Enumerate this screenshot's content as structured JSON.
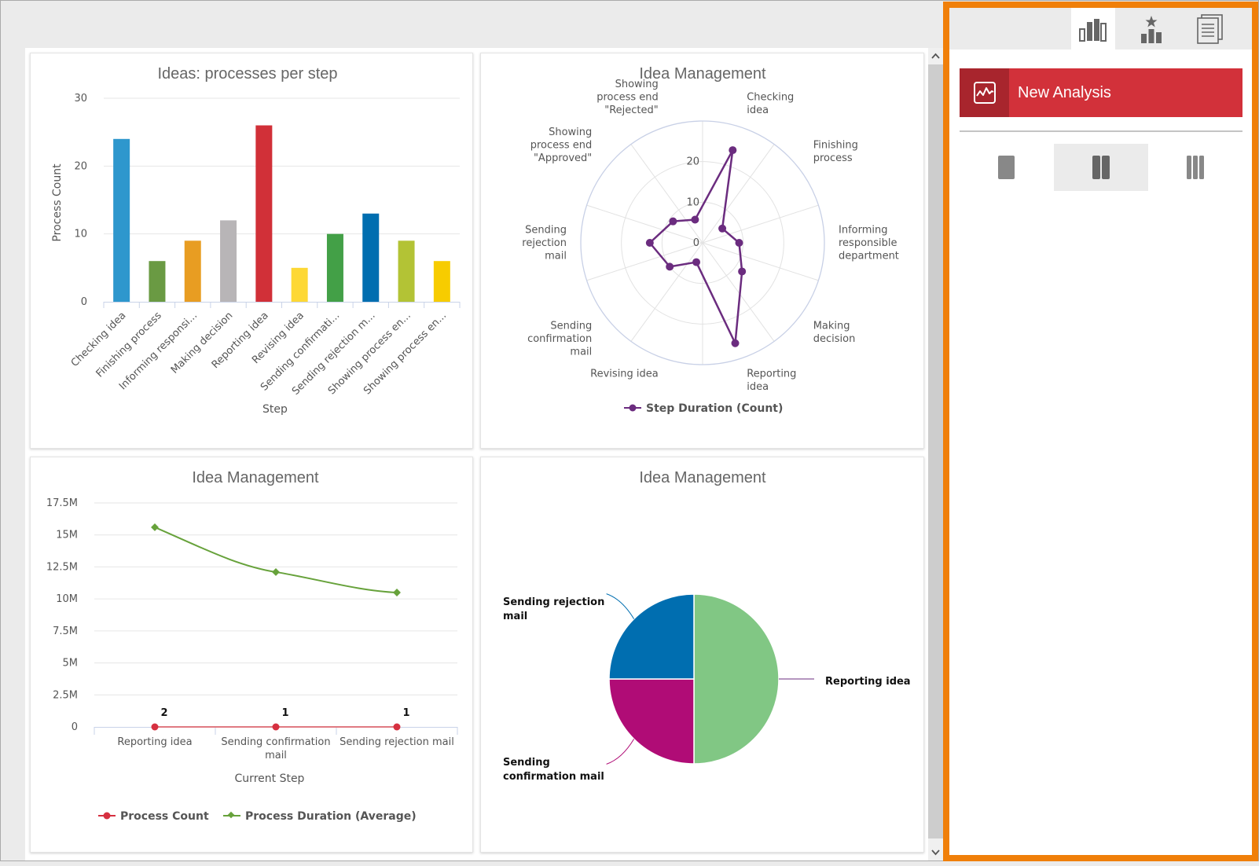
{
  "colors": {
    "accent_orange": "#f07f09",
    "new_analysis_red": "#d2313a",
    "new_analysis_dark": "#a8252d",
    "radar_series": "#6b2c7f",
    "line_duration": "#67a23b",
    "line_count": "#d63040"
  },
  "side_panel": {
    "tabs": [
      {
        "icon": "bar-chart-icon",
        "active": true
      },
      {
        "icon": "favorite-chart-icon",
        "active": false
      },
      {
        "icon": "documents-icon",
        "active": false
      }
    ],
    "new_analysis": {
      "label": "New Analysis",
      "icon": "activity-chart-icon"
    },
    "layouts": [
      {
        "icon": "one-column-layout-icon",
        "active": false
      },
      {
        "icon": "two-column-layout-icon",
        "active": true
      },
      {
        "icon": "three-column-layout-icon",
        "active": false
      }
    ]
  },
  "scrollbar": {
    "up_icon": "⌃",
    "down_icon": "⌄"
  },
  "chart_data": [
    {
      "type": "bar",
      "title": "Ideas: processes per step",
      "xlabel": "Step",
      "ylabel": "Process Count",
      "ylim": [
        0,
        30
      ],
      "yticks": [
        "0",
        "10",
        "20",
        "30"
      ],
      "grid": true,
      "categories": [
        "Checking idea",
        "Finishing process",
        "Informing responsi...",
        "Making decision",
        "Reporting idea",
        "Revising idea",
        "Sending confirmati...",
        "Sending rejection m...",
        "Showing process en...",
        "Showing process en..."
      ],
      "values": [
        24,
        6,
        9,
        12,
        26,
        5,
        10,
        13,
        9,
        6
      ],
      "colors": [
        "#2e97cd",
        "#6a9a43",
        "#e89d22",
        "#b8b5b7",
        "#d13038",
        "#fdd835",
        "#43a047",
        "#006eb0",
        "#b3c335",
        "#f7cc00"
      ]
    },
    {
      "type": "radar",
      "title": "Idea Management",
      "categories": [
        "Checking idea",
        "Finishing process",
        "Informing responsible department",
        "Making decision",
        "Reporting idea",
        "Revising idea",
        "Sending confirmation mail",
        "Sending rejection mail",
        "Showing process end \"Approved\"",
        "Showing process end \"Rejected\""
      ],
      "series": [
        {
          "name": "Step Duration (Count)",
          "values": [
            24,
            6,
            9,
            12,
            26,
            5,
            10,
            13,
            9,
            6
          ]
        }
      ],
      "rlim": [
        0,
        30
      ],
      "rticks": [
        "0",
        "10",
        "20"
      ],
      "legend": "bottom"
    },
    {
      "type": "line",
      "title": "Idea Management",
      "xlabel": "Current Step",
      "ylabel": "",
      "categories": [
        "Reporting idea",
        "Sending confirmation mail",
        "Sending rejection mail"
      ],
      "ylim": [
        0,
        17500000
      ],
      "yticks": [
        "0",
        "2.5M",
        "5M",
        "7.5M",
        "10M",
        "12.5M",
        "15M",
        "17.5M"
      ],
      "series": [
        {
          "name": "Process Count",
          "values": [
            2,
            1,
            1
          ],
          "labels": [
            "2",
            "1",
            "1"
          ]
        },
        {
          "name": "Process Duration (Average)",
          "values": [
            15600000,
            12100000,
            10500000
          ]
        }
      ],
      "legend": "bottom",
      "grid": true
    },
    {
      "type": "pie",
      "title": "Idea Management",
      "slices": [
        {
          "label": "Reporting idea",
          "value": 2,
          "percent": 50,
          "color": "#81c784"
        },
        {
          "label": "Sending confirmation mail",
          "value": 1,
          "percent": 25,
          "color": "#b00c76"
        },
        {
          "label": "Sending rejection mail",
          "value": 1,
          "percent": 25,
          "color": "#006eb0"
        }
      ]
    }
  ]
}
